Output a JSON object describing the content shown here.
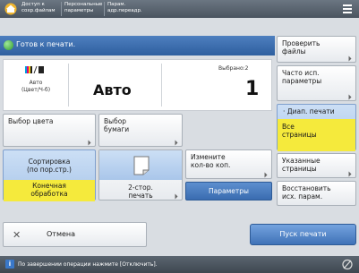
{
  "topbar": {
    "tabs": [
      {
        "line1": "Доступ к",
        "line2": "сохр.файлам"
      },
      {
        "line1": "Персональные",
        "line2": "параметры"
      },
      {
        "line1": "Парам.",
        "line2": "адр.переадр."
      }
    ],
    "menu_icon": "hamburger-menu-icon"
  },
  "status": {
    "text": "Готов к печати."
  },
  "summary": {
    "color_label_line1": "Авто",
    "color_label_line2": "(Цвет/Ч-б)",
    "paper": "Авто",
    "copies_label": "Выбрано:2",
    "copies": "1"
  },
  "buttons": {
    "color_select": "Выбор цвета",
    "paper_select_line1": "Выбор",
    "paper_select_line2": "бумаги",
    "sort_line1": "Сортировка",
    "sort_line2": "(по пор.стр.)",
    "finishing_line1": "Конечная",
    "finishing_line2": "обработка",
    "duplex_line1": "2-стор.",
    "duplex_line2": "печать",
    "change_copies_line1": "Измените",
    "change_copies_line2": "кол-во коп.",
    "params": "Параметры",
    "cancel": "Отмена",
    "start": "Пуск печати"
  },
  "side": {
    "check_files_line1": "Проверить",
    "check_files_line2": "файлы",
    "frequent_line1": "Часто исп.",
    "frequent_line2": "параметры",
    "range_header": "Диап. печати",
    "range_value_line1": "Все",
    "range_value_line2": "страницы",
    "specified_line1": "Указанные",
    "specified_line2": "страницы",
    "restore_line1": "Восстановить",
    "restore_line2": "исх. парам."
  },
  "footer": {
    "text": "По завершении операции нажмите [Отключить]."
  },
  "colors": {
    "accent_blue": "#3a6cb0",
    "highlight_yellow": "#f5ea3c",
    "ready_green": "#2f9a2a"
  }
}
